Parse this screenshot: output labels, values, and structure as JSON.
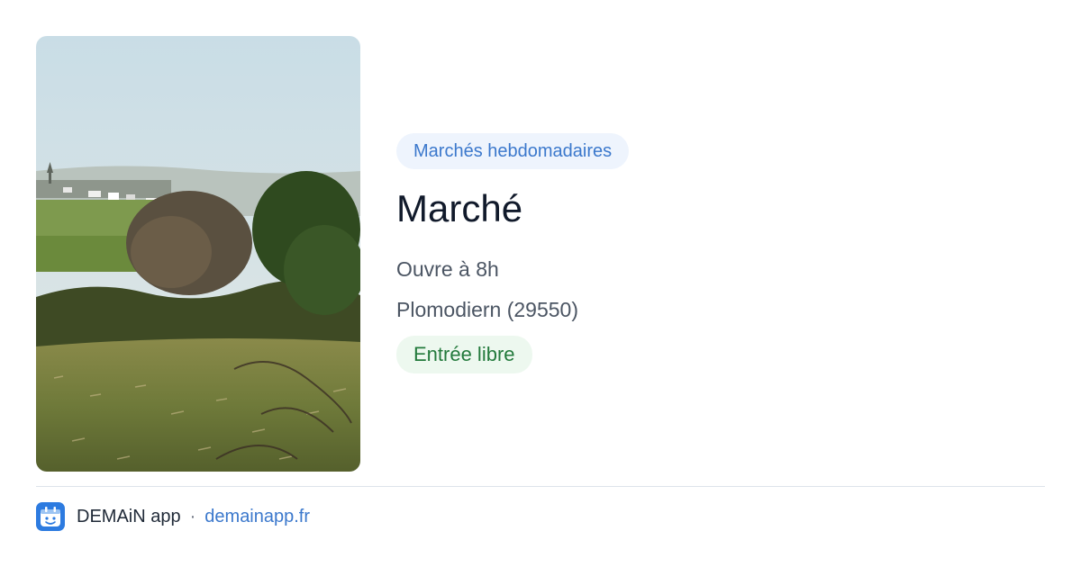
{
  "listing": {
    "category": "Marchés hebdomadaires",
    "title": "Marché",
    "hours": "Ouvre à 8h",
    "location": "Plomodiern (29550)",
    "access": "Entrée libre"
  },
  "photo": {
    "subject": "countryside-landscape-photo"
  },
  "footer": {
    "app_name": "DEMAiN app",
    "separator": "·",
    "site": "demainapp.fr",
    "icon": "demain-app-icon"
  },
  "colors": {
    "accent": "#3b78cc",
    "category_chip_bg": "#eef4fd",
    "access_chip_bg": "#edf8ef",
    "access_chip_text": "#237a3c",
    "title_text": "#111a2b",
    "body_text": "#4b5563"
  }
}
